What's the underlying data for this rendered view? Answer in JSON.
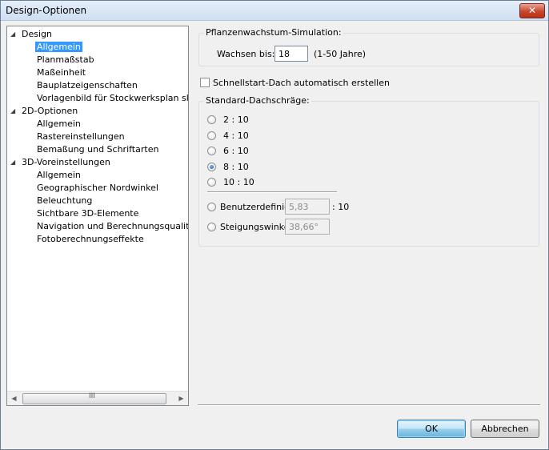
{
  "window": {
    "title": "Design-Optionen",
    "close_glyph": "✕"
  },
  "tree": {
    "expanded_glyph": "◢",
    "items": [
      {
        "label": "Design",
        "level": 0,
        "expanded": true
      },
      {
        "label": "Allgemein",
        "level": 1,
        "selected": true
      },
      {
        "label": "Planmaßstab",
        "level": 1
      },
      {
        "label": "Maßeinheit",
        "level": 1
      },
      {
        "label": "Bauplatzeigenschaften",
        "level": 1
      },
      {
        "label": "Vorlagenbild für Stockwerksplan skalieren",
        "level": 1
      },
      {
        "label": "2D-Optionen",
        "level": 0,
        "expanded": true
      },
      {
        "label": "Allgemein",
        "level": 1
      },
      {
        "label": "Rastereinstellungen",
        "level": 1
      },
      {
        "label": "Bemaßung und Schriftarten",
        "level": 1
      },
      {
        "label": "3D-Voreinstellungen",
        "level": 0,
        "expanded": true
      },
      {
        "label": "Allgemein",
        "level": 1
      },
      {
        "label": "Geographischer Nordwinkel",
        "level": 1
      },
      {
        "label": "Beleuchtung",
        "level": 1
      },
      {
        "label": "Sichtbare 3D-Elemente",
        "level": 1
      },
      {
        "label": "Navigation und Berechnungsqualität",
        "level": 1
      },
      {
        "label": "Fotoberechnungseffekte",
        "level": 1
      }
    ],
    "scroll_left": "◀",
    "scroll_right": "▶",
    "scroll_grip": "III"
  },
  "growth": {
    "group_label": "Pflanzenwachstum-Simulation:",
    "label": "Wachsen bis:",
    "value": "18",
    "hint": "(1-50 Jahre)"
  },
  "quickstart": {
    "label": "Schnellstart-Dach automatisch erstellen",
    "checked": false
  },
  "pitch": {
    "group_label": "Standard-Dachschräge:",
    "options": [
      {
        "label": "2 : 10",
        "checked": false
      },
      {
        "label": "4 : 10",
        "checked": false
      },
      {
        "label": "6 : 10",
        "checked": false
      },
      {
        "label": "8 : 10",
        "checked": true
      },
      {
        "label": "10 : 10",
        "checked": false
      }
    ],
    "custom": {
      "label": "Benutzerdefiniert",
      "value": "5,83",
      "suffix": ": 10",
      "checked": false
    },
    "angle": {
      "label": "Steigungswinkel",
      "value": "38,66°",
      "checked": false
    }
  },
  "buttons": {
    "ok": "OK",
    "cancel": "Abbrechen"
  }
}
